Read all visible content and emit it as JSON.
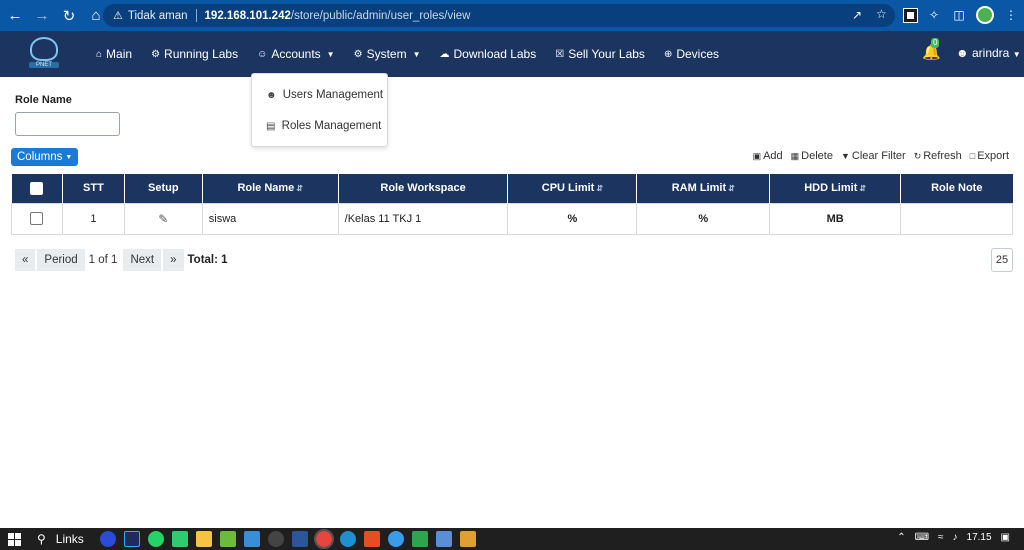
{
  "browser": {
    "security_label": "Tidak aman",
    "url_host": "192.168.101.242",
    "url_path": "/store/public/admin/user_roles/view"
  },
  "app": {
    "logo_text": "PNET",
    "menu": [
      {
        "label": "Main",
        "icon": "home-icon"
      },
      {
        "label": "Running Labs",
        "icon": "cogs-icon"
      },
      {
        "label": "Accounts",
        "icon": "users-icon",
        "has_caret": true
      },
      {
        "label": "System",
        "icon": "gear-icon",
        "has_caret": true
      },
      {
        "label": "Download Labs",
        "icon": "cloud-download-icon"
      },
      {
        "label": "Sell Your Labs",
        "icon": "cart-icon"
      },
      {
        "label": "Devices",
        "icon": "plus-circle-icon"
      }
    ],
    "notification_count": "0",
    "user_name": "arindra"
  },
  "accounts_dropdown": {
    "items": [
      {
        "label": "Users Management",
        "icon": "user-icon"
      },
      {
        "label": "Roles Management",
        "icon": "id-card-icon"
      }
    ]
  },
  "filter": {
    "label": "Role Name",
    "value": ""
  },
  "columns_button": "Columns",
  "toolbar": {
    "add": "Add",
    "delete": "Delete",
    "clear_filter": "Clear Filter",
    "refresh": "Refresh",
    "export": "Export"
  },
  "table": {
    "headers": [
      "STT",
      "Setup",
      "Role Name",
      "Role Workspace",
      "CPU Limit",
      "RAM Limit",
      "HDD Limit",
      "Role Note"
    ],
    "rows": [
      {
        "stt": "1",
        "role_name": "siswa",
        "role_workspace": "/Kelas 11 TKJ 1",
        "cpu_limit": "%",
        "ram_limit": "%",
        "hdd_limit": "MB",
        "role_note": ""
      }
    ]
  },
  "pager": {
    "first": "«",
    "period": "Period",
    "page_info": "1 of 1",
    "next": "Next",
    "last": "»",
    "total": "Total: 1",
    "page_size": "25"
  },
  "taskbar": {
    "search_label": "Links",
    "time": "17.15"
  },
  "colors": {
    "browser_bar": "#0a57a6",
    "nav": "#1c3560",
    "primary_button": "#1a7bd6"
  }
}
